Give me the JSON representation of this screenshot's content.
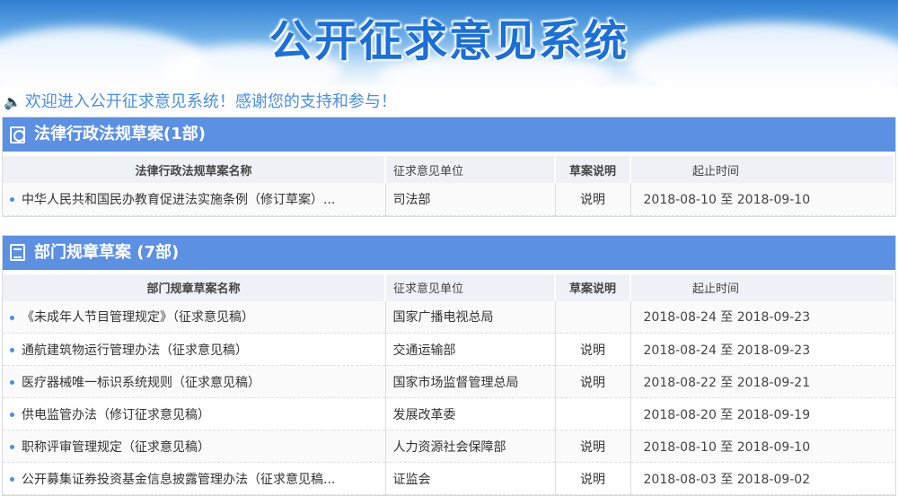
{
  "header": {
    "title": "公开征求意见系统"
  },
  "welcome": "欢迎进入公开征求意见系统！感谢您的支持和参与！",
  "sections": [
    {
      "title": "法律行政法规草案(1部)",
      "columns": [
        "法律行政法规草案名称",
        "征求意见单位",
        "草案说明",
        "起止时间"
      ],
      "rows": [
        {
          "name": "中华人民共和国民办教育促进法实施条例（修订草案）...",
          "unit": "司法部",
          "note": "说明",
          "time": "2018-08-10 至 2018-09-10"
        }
      ]
    },
    {
      "title": "部门规章草案 (7部)",
      "columns": [
        "部门规章草案名称",
        "征求意见单位",
        "草案说明",
        "起止时间"
      ],
      "rows": [
        {
          "name": "《未成年人节目管理规定》（征求意见稿）",
          "unit": "国家广播电视总局",
          "note": "",
          "time": "2018-08-24 至 2018-09-23"
        },
        {
          "name": "通航建筑物运行管理办法（征求意见稿）",
          "unit": "交通运输部",
          "note": "说明",
          "time": "2018-08-24 至 2018-09-23"
        },
        {
          "name": "医疗器械唯一标识系统规则（征求意见稿）",
          "unit": "国家市场监督管理总局",
          "note": "说明",
          "time": "2018-08-22 至 2018-09-21"
        },
        {
          "name": "供电监管办法（修订征求意见稿）",
          "unit": "发展改革委",
          "note": "",
          "time": "2018-08-20 至 2018-09-19"
        },
        {
          "name": "职称评审管理规定（征求意见稿）",
          "unit": "人力资源社会保障部",
          "note": "说明",
          "time": "2018-08-10 至 2018-09-10"
        },
        {
          "name": "公开募集证券投资基金信息披露管理办法（征求意见稿...",
          "unit": "证监会",
          "note": "说明",
          "time": "2018-08-03 至 2018-09-02"
        }
      ]
    }
  ]
}
